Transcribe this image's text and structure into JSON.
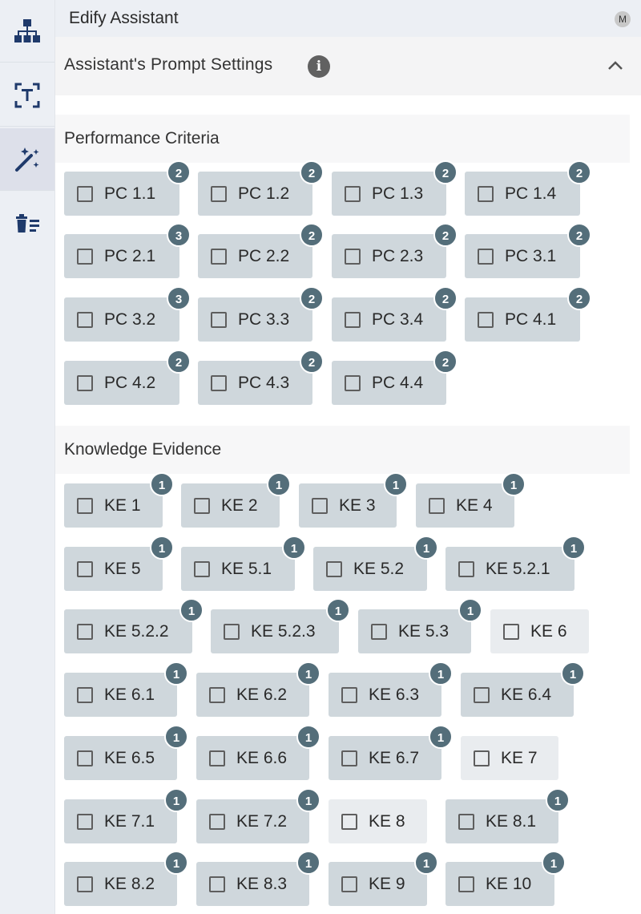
{
  "app": {
    "title": "Edify Assistant",
    "avatar_initial": "M"
  },
  "rail": {
    "items": [
      {
        "icon": "sitemap-icon",
        "active": false
      },
      {
        "icon": "text-frame-icon",
        "active": false
      },
      {
        "icon": "magic-wand-icon",
        "active": true
      },
      {
        "icon": "delete-list-icon",
        "active": false
      }
    ]
  },
  "settings": {
    "title": "Assistant's Prompt Settings",
    "info_symbol": "i",
    "expanded": true
  },
  "performance_criteria": {
    "title": "Performance Criteria",
    "items": [
      {
        "label": "PC 1.1",
        "count": "2"
      },
      {
        "label": "PC 1.2",
        "count": "2"
      },
      {
        "label": "PC 1.3",
        "count": "2"
      },
      {
        "label": "PC 1.4",
        "count": "2"
      },
      {
        "label": "PC 2.1",
        "count": "3"
      },
      {
        "label": "PC 2.2",
        "count": "2"
      },
      {
        "label": "PC 2.3",
        "count": "2"
      },
      {
        "label": "PC 3.1",
        "count": "2"
      },
      {
        "label": "PC 3.2",
        "count": "3"
      },
      {
        "label": "PC 3.3",
        "count": "2"
      },
      {
        "label": "PC 3.4",
        "count": "2"
      },
      {
        "label": "PC 4.1",
        "count": "2"
      },
      {
        "label": "PC 4.2",
        "count": "2"
      },
      {
        "label": "PC 4.3",
        "count": "2"
      },
      {
        "label": "PC 4.4",
        "count": "2"
      }
    ]
  },
  "knowledge_evidence": {
    "title": "Knowledge Evidence",
    "items": [
      {
        "label": "KE 1",
        "count": "1"
      },
      {
        "label": "KE 2",
        "count": "1"
      },
      {
        "label": "KE 3",
        "count": "1"
      },
      {
        "label": "KE 4",
        "count": "1"
      },
      {
        "label": "KE 5",
        "count": "1"
      },
      {
        "label": "KE 5.1",
        "count": "1"
      },
      {
        "label": "KE 5.2",
        "count": "1"
      },
      {
        "label": "KE 5.2.1",
        "count": "1"
      },
      {
        "label": "KE 5.2.2",
        "count": "1"
      },
      {
        "label": "KE 5.2.3",
        "count": "1"
      },
      {
        "label": "KE 5.3",
        "count": "1"
      },
      {
        "label": "KE 6",
        "count": ""
      },
      {
        "label": "KE 6.1",
        "count": "1"
      },
      {
        "label": "KE 6.2",
        "count": "1"
      },
      {
        "label": "KE 6.3",
        "count": "1"
      },
      {
        "label": "KE 6.4",
        "count": "1"
      },
      {
        "label": "KE 6.5",
        "count": "1"
      },
      {
        "label": "KE 6.6",
        "count": "1"
      },
      {
        "label": "KE 6.7",
        "count": "1"
      },
      {
        "label": "KE 7",
        "count": ""
      },
      {
        "label": "KE 7.1",
        "count": "1"
      },
      {
        "label": "KE 7.2",
        "count": "1"
      },
      {
        "label": "KE 8",
        "count": ""
      },
      {
        "label": "KE 8.1",
        "count": "1"
      },
      {
        "label": "KE 8.2",
        "count": "1"
      },
      {
        "label": "KE 8.3",
        "count": "1"
      },
      {
        "label": "KE 9",
        "count": "1"
      },
      {
        "label": "KE 10",
        "count": "1"
      }
    ]
  }
}
